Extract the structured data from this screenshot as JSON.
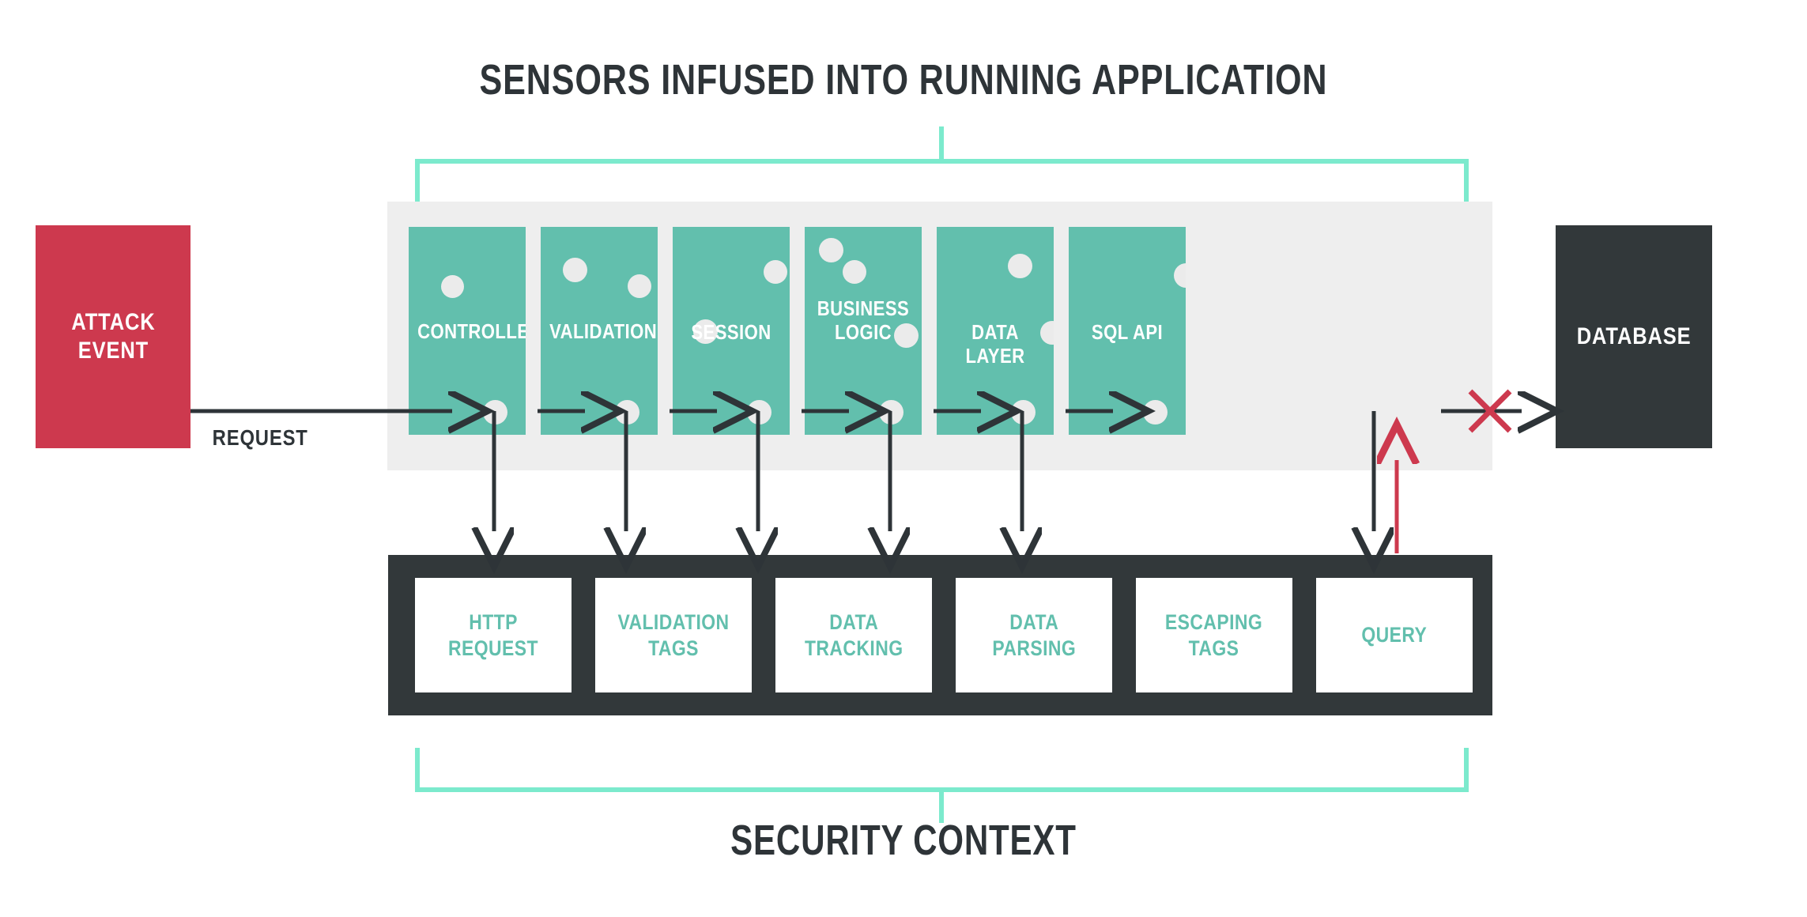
{
  "colors": {
    "attack_red": "#cd394e",
    "teal": "#62bfad",
    "mint_bracket": "#7ceacd",
    "dark": "#32383a",
    "panel_gray": "#eeeeee",
    "dot_gray": "#ebebeb",
    "arrow_dark": "#2e3438",
    "block_red": "#cd394e"
  },
  "headings": {
    "top": "SENSORS INFUSED INTO RUNNING APPLICATION",
    "bottom": "SECURITY CONTEXT"
  },
  "attack": {
    "line1": "ATTACK",
    "line2": "EVENT"
  },
  "database": {
    "label": "DATABASE"
  },
  "flow_label": {
    "request": "REQUEST"
  },
  "stages": [
    {
      "label": "CONTROLLER",
      "lines": [
        "CONTROLLER"
      ]
    },
    {
      "label": "VALIDATION",
      "lines": [
        "VALIDATION"
      ]
    },
    {
      "label": "SESSION",
      "lines": [
        "SESSION"
      ]
    },
    {
      "label": "BUSINESS LOGIC",
      "lines": [
        "BUSINESS",
        "LOGIC"
      ]
    },
    {
      "label": "DATA LAYER",
      "lines": [
        "DATA LAYER"
      ]
    },
    {
      "label": "SQL API",
      "lines": [
        "SQL API"
      ]
    }
  ],
  "sensors": [
    {
      "label": "HTTP REQUEST",
      "lines": [
        "HTTP",
        "REQUEST"
      ]
    },
    {
      "label": "VALIDATION TAGS",
      "lines": [
        "VALIDATION",
        "TAGS"
      ]
    },
    {
      "label": "DATA TRACKING",
      "lines": [
        "DATA",
        "TRACKING"
      ]
    },
    {
      "label": "DATA PARSING",
      "lines": [
        "DATA",
        "PARSING"
      ]
    },
    {
      "label": "ESCAPING TAGS",
      "lines": [
        "ESCAPING",
        "TAGS"
      ]
    },
    {
      "label": "QUERY",
      "lines": [
        "QUERY"
      ]
    }
  ],
  "markers": {
    "blocked": "x-block-marker",
    "blocked_meaning": "attack blocked before database"
  }
}
